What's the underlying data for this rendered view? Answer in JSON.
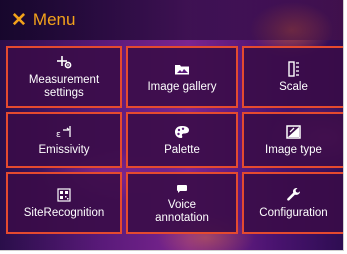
{
  "header": {
    "close_symbol": "✕",
    "title": "Menu",
    "accent_color": "#f3a21b"
  },
  "tiles": [
    {
      "label": "Measurement\nsettings",
      "icon": "measurement-settings-icon"
    },
    {
      "label": "Image gallery",
      "icon": "image-gallery-icon"
    },
    {
      "label": "Scale",
      "icon": "scale-icon"
    },
    {
      "label": "Emissivity",
      "icon": "emissivity-icon"
    },
    {
      "label": "Palette",
      "icon": "palette-icon"
    },
    {
      "label": "Image type",
      "icon": "image-type-icon"
    },
    {
      "label": "SiteRecognition",
      "icon": "qr-code-icon"
    },
    {
      "label": "Voice\nannotation",
      "icon": "voice-annotation-icon"
    },
    {
      "label": "Configuration",
      "icon": "wrench-icon"
    }
  ],
  "colors": {
    "tile_border": "#e54a2f",
    "tile_text": "#ffffff"
  }
}
